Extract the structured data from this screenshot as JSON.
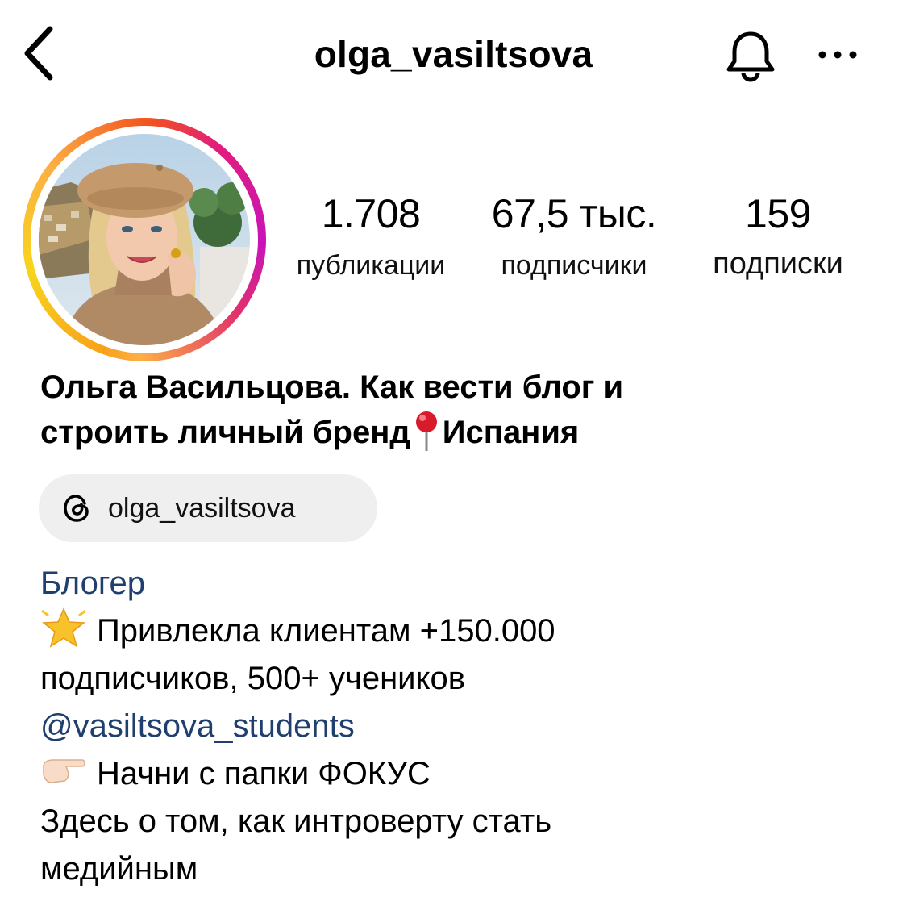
{
  "header": {
    "username": "olga_vasiltsova",
    "back_icon": "chevron-left-icon",
    "bell_icon": "bell-icon",
    "more_icon": "more-horizontal-icon"
  },
  "avatar": {
    "story_ring": true,
    "ring_colors": [
      "#f9a01b",
      "#e1306c",
      "#c913b9"
    ]
  },
  "stats": [
    {
      "value": "1.708",
      "label": "публикации"
    },
    {
      "value": "67,5 тыс.",
      "label": "подписчики"
    },
    {
      "value": "159",
      "label": "подписки"
    }
  ],
  "profile": {
    "name_line1": "Ольга Васильцова. Как вести блог и",
    "name_line2_before": "строить личный бренд",
    "name_line2_after": "Испания",
    "pin_icon": "round-pushpin-icon"
  },
  "threads": {
    "icon": "threads-icon",
    "handle": "olga_vasiltsova"
  },
  "bio": {
    "category": "Блогер",
    "line1": "Привлекла клиентам +150.000",
    "line1_icon": "glowing-star-icon",
    "line2": "подписчиков, 500+ учеников",
    "mention": "@vasiltsova_students",
    "line4": "Начни с папки ФОКУС",
    "line4_icon": "pointing-right-icon",
    "line5": "Здесь о том, как интроверту стать",
    "line6": "медийным"
  },
  "colors": {
    "link": "#1f3f6e",
    "chip_background": "#efefef"
  }
}
